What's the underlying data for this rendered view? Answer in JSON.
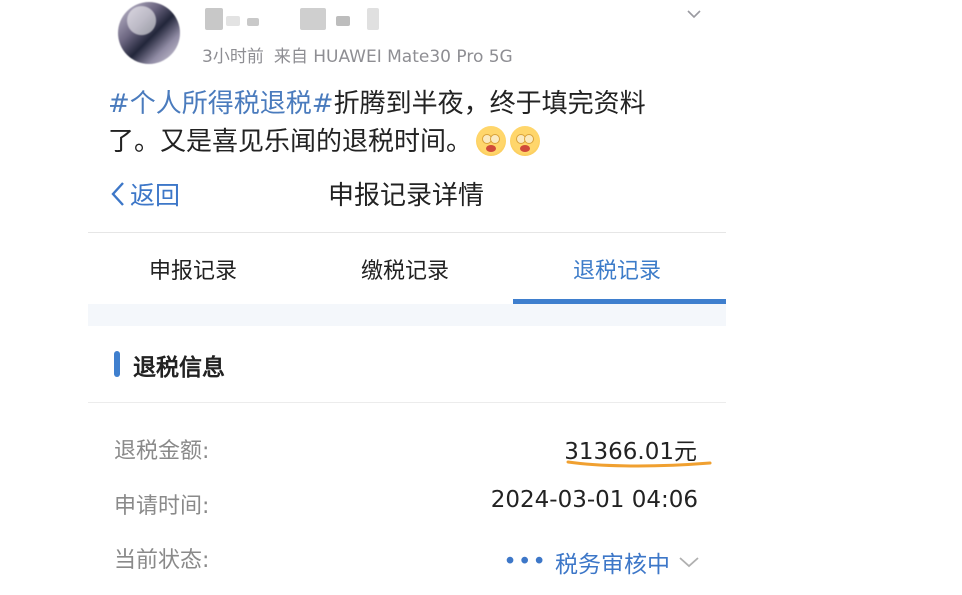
{
  "post": {
    "time_ago": "3小时前",
    "source": "来自 HUAWEI Mate30 Pro 5G",
    "hashtag": "#个人所得税退税#",
    "text_line1": "折腾到半夜，终于填完资料",
    "text_line2": "了。又是喜见乐闻的退税时间。"
  },
  "nav": {
    "back_label": "返回",
    "title": "申报记录详情"
  },
  "tabs": [
    {
      "label": "申报记录"
    },
    {
      "label": "缴税记录"
    },
    {
      "label": "退税记录",
      "active": true
    }
  ],
  "section": {
    "title": "退税信息"
  },
  "details": {
    "amount_label": "退税金额:",
    "amount_value": "31366.01元",
    "time_label": "申请时间:",
    "time_value": "2024-03-01 04:06",
    "status_label": "当前状态:",
    "status_value": "税务审核中",
    "status_dots": "•••"
  },
  "colors": {
    "accent": "#3f7fce",
    "hashtag": "#4a7bbd",
    "highlight_underline": "#f0a030"
  },
  "icons": [
    "chevron-down-icon",
    "back-chevron-icon",
    "emoji-icon"
  ]
}
